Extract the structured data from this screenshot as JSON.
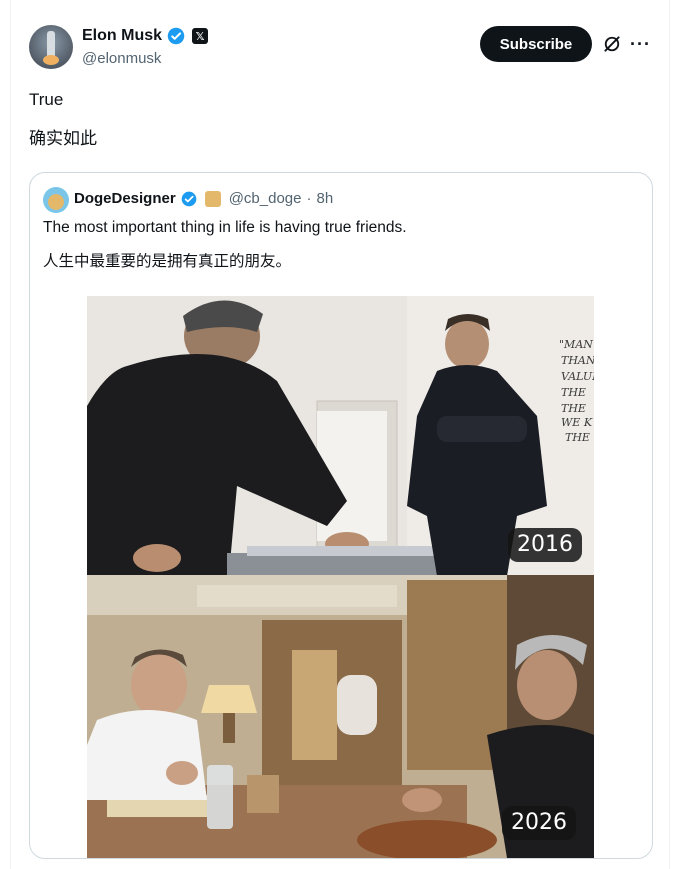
{
  "author": {
    "name": "Elon Musk",
    "handle": "@elonmusk"
  },
  "subscribe_label": "Subscribe",
  "more_label": "···",
  "x_badge": "𝕏",
  "post_lines": [
    "True",
    "确实如此"
  ],
  "quote": {
    "name": "DogeDesigner",
    "handle": "@cb_doge",
    "separator": "·",
    "time": "8h",
    "lines": [
      "The most important thing in life is having true friends.",
      "人生中最重要的是拥有真正的朋友。"
    ],
    "photos": [
      {
        "year": "2016"
      },
      {
        "year": "2026"
      }
    ]
  },
  "colors": {
    "verified_blue": "#1d9bf0",
    "text": "#0f1419",
    "muted": "#536471",
    "border": "#cfd9de"
  }
}
